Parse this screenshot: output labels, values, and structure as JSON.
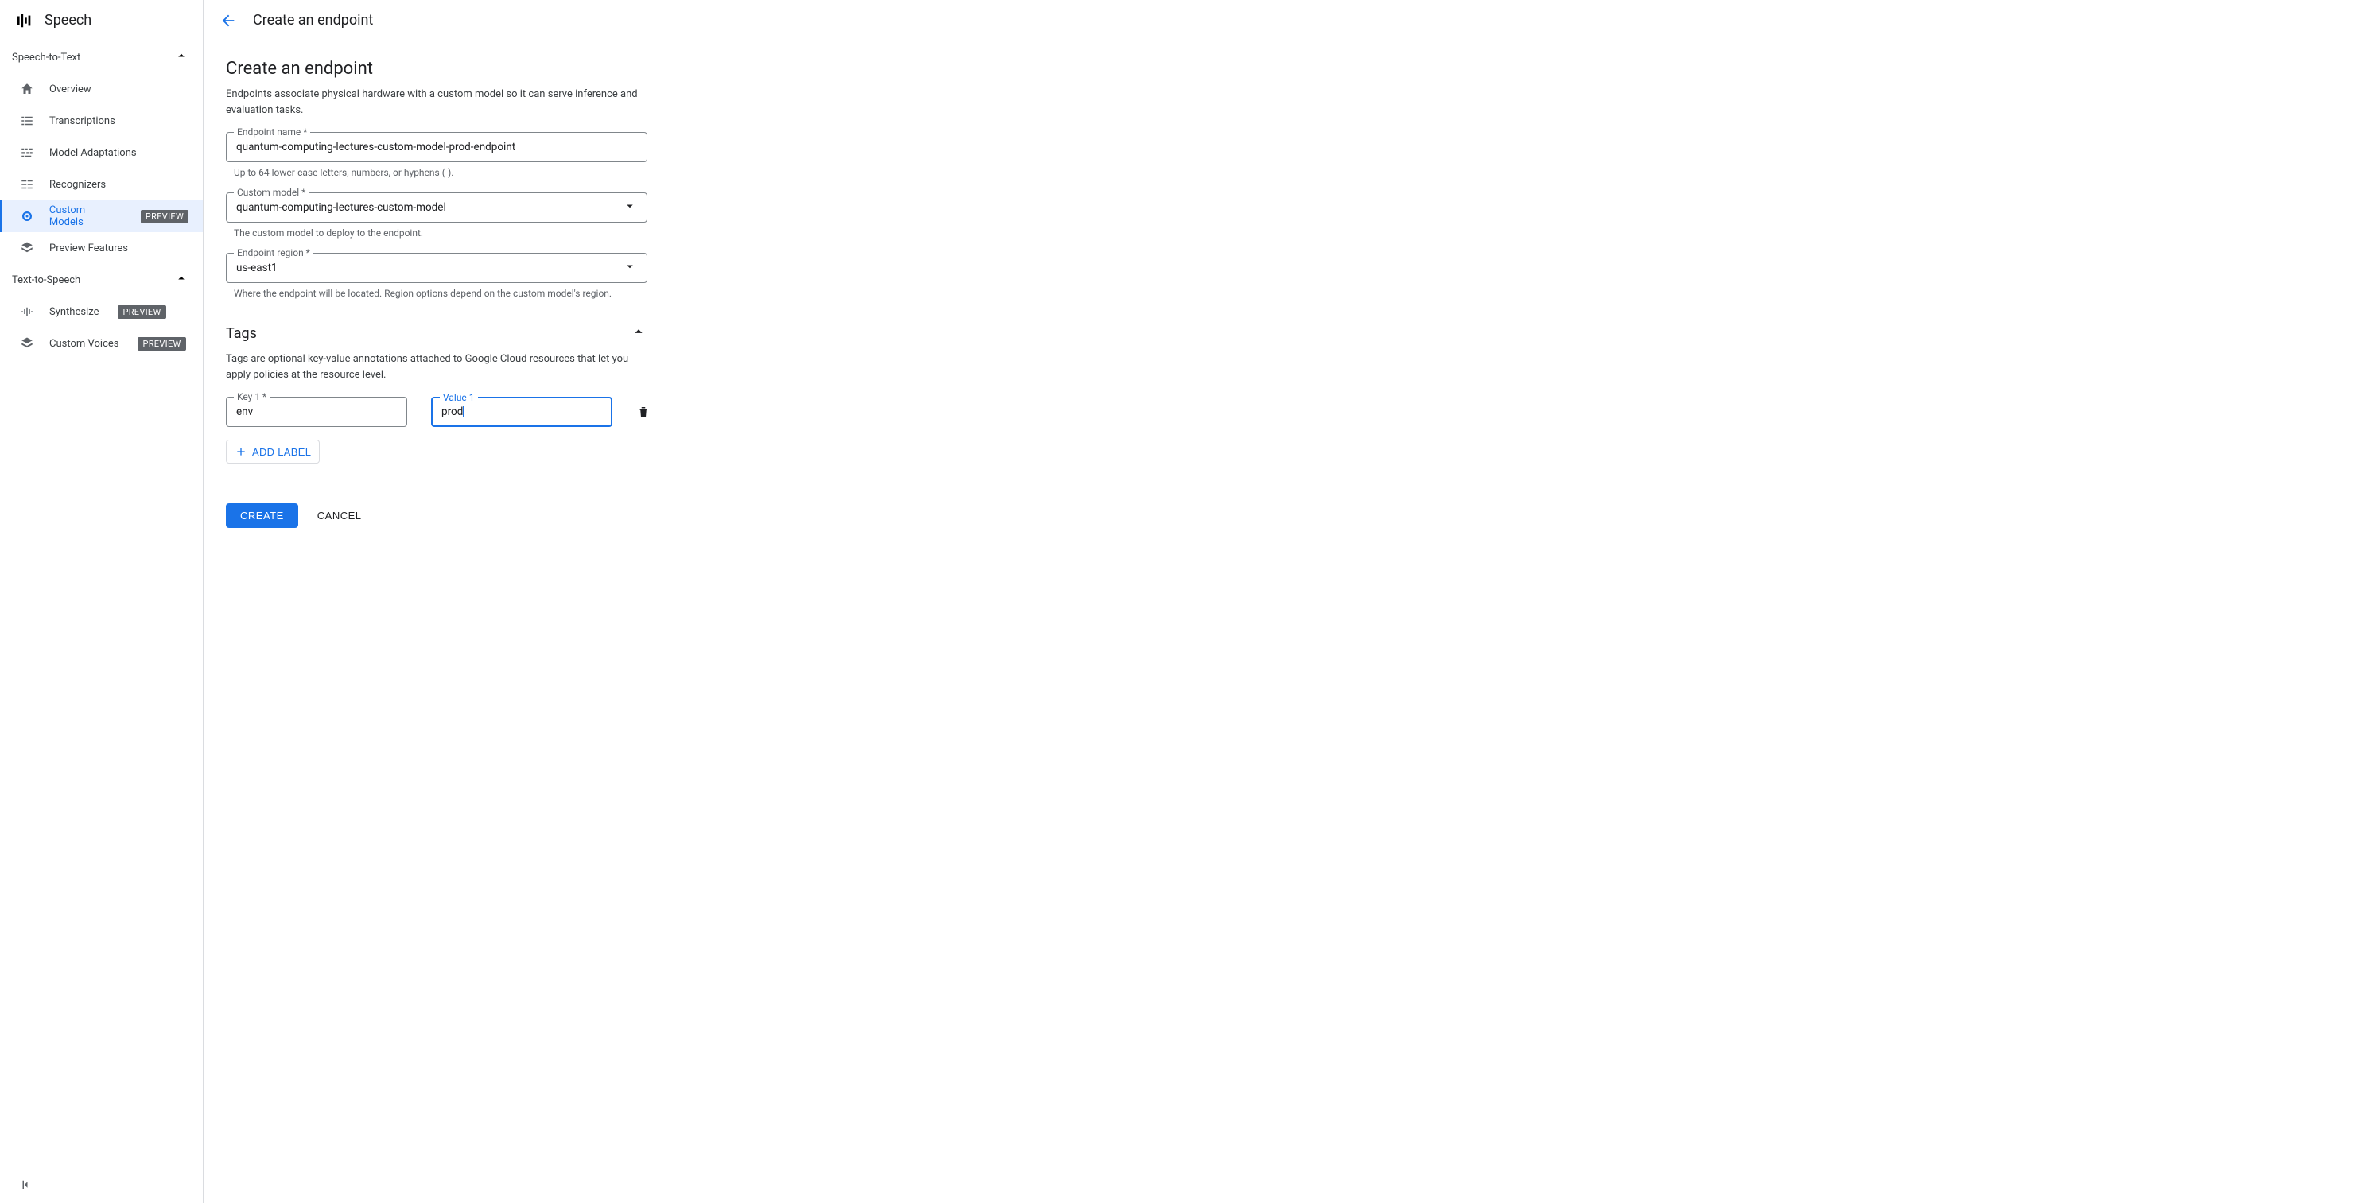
{
  "sidebar": {
    "product": "Speech",
    "sections": [
      {
        "label": "Speech-to-Text",
        "items": [
          {
            "label": "Overview",
            "icon": "home-icon"
          },
          {
            "label": "Transcriptions",
            "icon": "list-icon"
          },
          {
            "label": "Model Adaptations",
            "icon": "sliders-icon"
          },
          {
            "label": "Recognizers",
            "icon": "rows-icon"
          },
          {
            "label": "Custom Models",
            "icon": "target-icon",
            "badge": "PREVIEW",
            "selected": true
          },
          {
            "label": "Preview Features",
            "icon": "layers-icon"
          }
        ]
      },
      {
        "label": "Text-to-Speech",
        "items": [
          {
            "label": "Synthesize",
            "icon": "wave-icon",
            "badge": "PREVIEW"
          },
          {
            "label": "Custom Voices",
            "icon": "layers-icon",
            "badge": "PREVIEW"
          }
        ]
      }
    ]
  },
  "header": {
    "title": "Create an endpoint"
  },
  "page": {
    "heading": "Create an endpoint",
    "description": "Endpoints associate physical hardware with a custom model so it can serve inference and evaluation tasks.",
    "endpoint_name": {
      "label": "Endpoint name *",
      "value": "quantum-computing-lectures-custom-model-prod-endpoint",
      "helper": "Up to 64 lower-case letters, numbers, or hyphens (-)."
    },
    "custom_model": {
      "label": "Custom model *",
      "value": "quantum-computing-lectures-custom-model",
      "helper": "The custom model to deploy to the endpoint."
    },
    "region": {
      "label": "Endpoint region *",
      "value": "us-east1",
      "helper": "Where the endpoint will be located. Region options depend on the custom model's region."
    },
    "tags": {
      "heading": "Tags",
      "description": "Tags are optional key-value annotations attached to Google Cloud resources that let you apply policies at the resource level.",
      "rows": [
        {
          "key_label": "Key 1 *",
          "key_value": "env",
          "value_label": "Value 1",
          "value_value": "prod",
          "value_focused": true
        }
      ],
      "add_label": "ADD LABEL"
    },
    "actions": {
      "create": "CREATE",
      "cancel": "CANCEL"
    }
  }
}
